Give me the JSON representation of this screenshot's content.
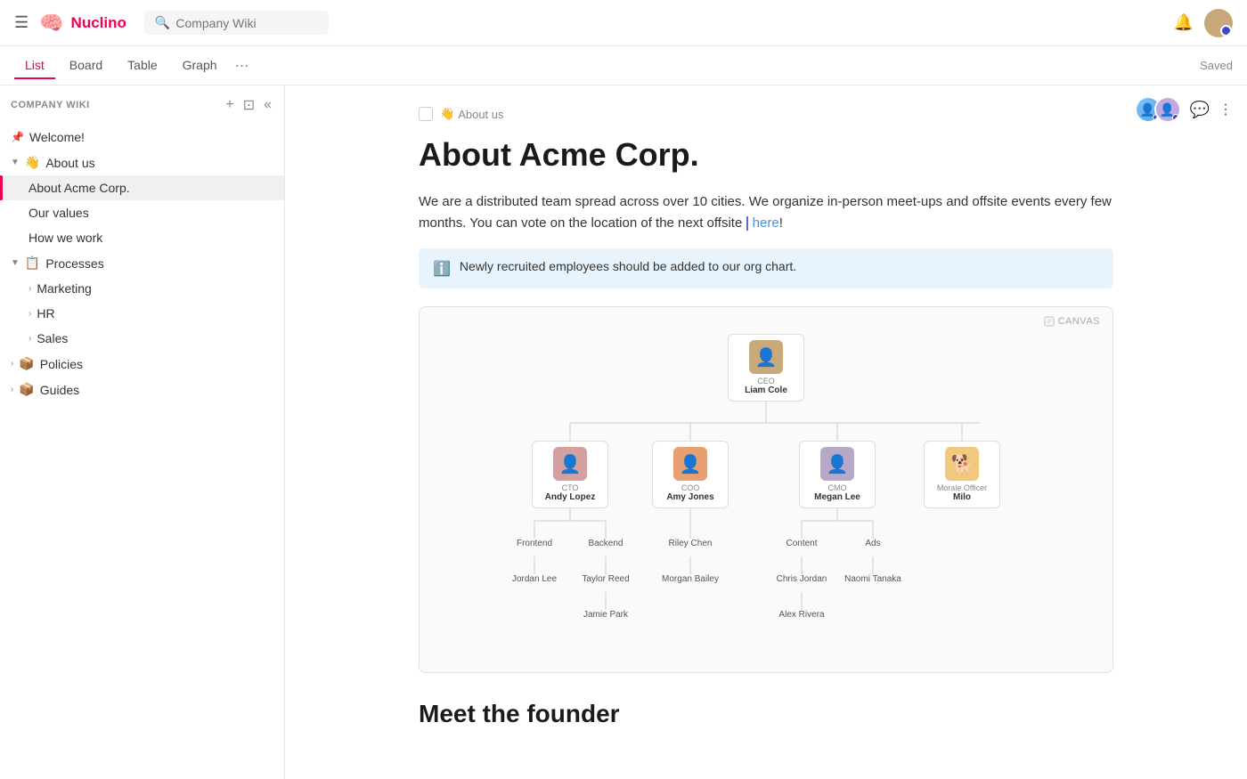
{
  "app": {
    "name": "Nuclino",
    "search_placeholder": "Company Wiki"
  },
  "tabs": [
    {
      "id": "list",
      "label": "List",
      "active": true
    },
    {
      "id": "board",
      "label": "Board",
      "active": false
    },
    {
      "id": "table",
      "label": "Table",
      "active": false
    },
    {
      "id": "graph",
      "label": "Graph",
      "active": false
    }
  ],
  "sidebar": {
    "title": "COMPANY WIKI",
    "items": [
      {
        "id": "welcome",
        "label": "Welcome!",
        "icon": "📌",
        "depth": 0,
        "pinned": true
      },
      {
        "id": "about-us",
        "label": "About us",
        "icon": "👋",
        "depth": 0,
        "expanded": true
      },
      {
        "id": "about-acme",
        "label": "About Acme Corp.",
        "depth": 1,
        "active": true
      },
      {
        "id": "our-values",
        "label": "Our values",
        "depth": 1
      },
      {
        "id": "how-we-work",
        "label": "How we work",
        "depth": 1
      },
      {
        "id": "processes",
        "label": "Processes",
        "icon": "📋",
        "depth": 0,
        "expanded": true
      },
      {
        "id": "marketing",
        "label": "Marketing",
        "depth": 1,
        "hasChildren": true
      },
      {
        "id": "hr",
        "label": "HR",
        "depth": 1,
        "hasChildren": true
      },
      {
        "id": "sales",
        "label": "Sales",
        "depth": 1,
        "hasChildren": true
      },
      {
        "id": "policies",
        "label": "Policies",
        "icon": "📦",
        "depth": 0
      },
      {
        "id": "guides",
        "label": "Guides",
        "icon": "📦",
        "depth": 0
      }
    ]
  },
  "page": {
    "breadcrumb_icon": "👋",
    "breadcrumb_label": "About us",
    "title": "About Acme Corp.",
    "body1": "We are a distributed team spread across over 10 cities. We organize in-person meet-ups and offsite events every few months. You can vote on the location of the next offsite ",
    "body1_link": "here",
    "body1_end": "!",
    "info_text": "Newly recruited employees should be added to our org chart.",
    "canvas_label": "CANVAS",
    "org_chart": {
      "ceo": {
        "role": "CEO",
        "name": "Liam Cole"
      },
      "level2": [
        {
          "role": "CTO",
          "name": "Andy Lopez"
        },
        {
          "role": "COO",
          "name": "Amy Jones"
        },
        {
          "role": "CMO",
          "name": "Megan Lee"
        },
        {
          "role": "Morale Officer",
          "name": "Milo"
        }
      ],
      "level3_cto": [
        {
          "label": "Frontend"
        },
        {
          "label": "Backend"
        }
      ],
      "level3_coo": [
        {
          "label": "Riley Chen"
        }
      ],
      "level3_cmo": [
        {
          "label": "Content"
        },
        {
          "label": "Ads"
        }
      ],
      "level4": [
        {
          "label": "Jordan Lee",
          "parent": "Frontend"
        },
        {
          "label": "Taylor Reed",
          "parent": "Backend"
        },
        {
          "label": "Morgan Bailey",
          "parent": "Riley Chen"
        },
        {
          "label": "Chris Jordan",
          "parent": "Content"
        },
        {
          "label": "Naomi Tanaka",
          "parent": "Ads"
        }
      ],
      "level5": [
        {
          "label": "Jamie Park",
          "parent": "Taylor Reed"
        },
        {
          "label": "Alex Rivera",
          "parent": "Chris Jordan"
        }
      ]
    },
    "section2_title": "Meet the founder"
  }
}
